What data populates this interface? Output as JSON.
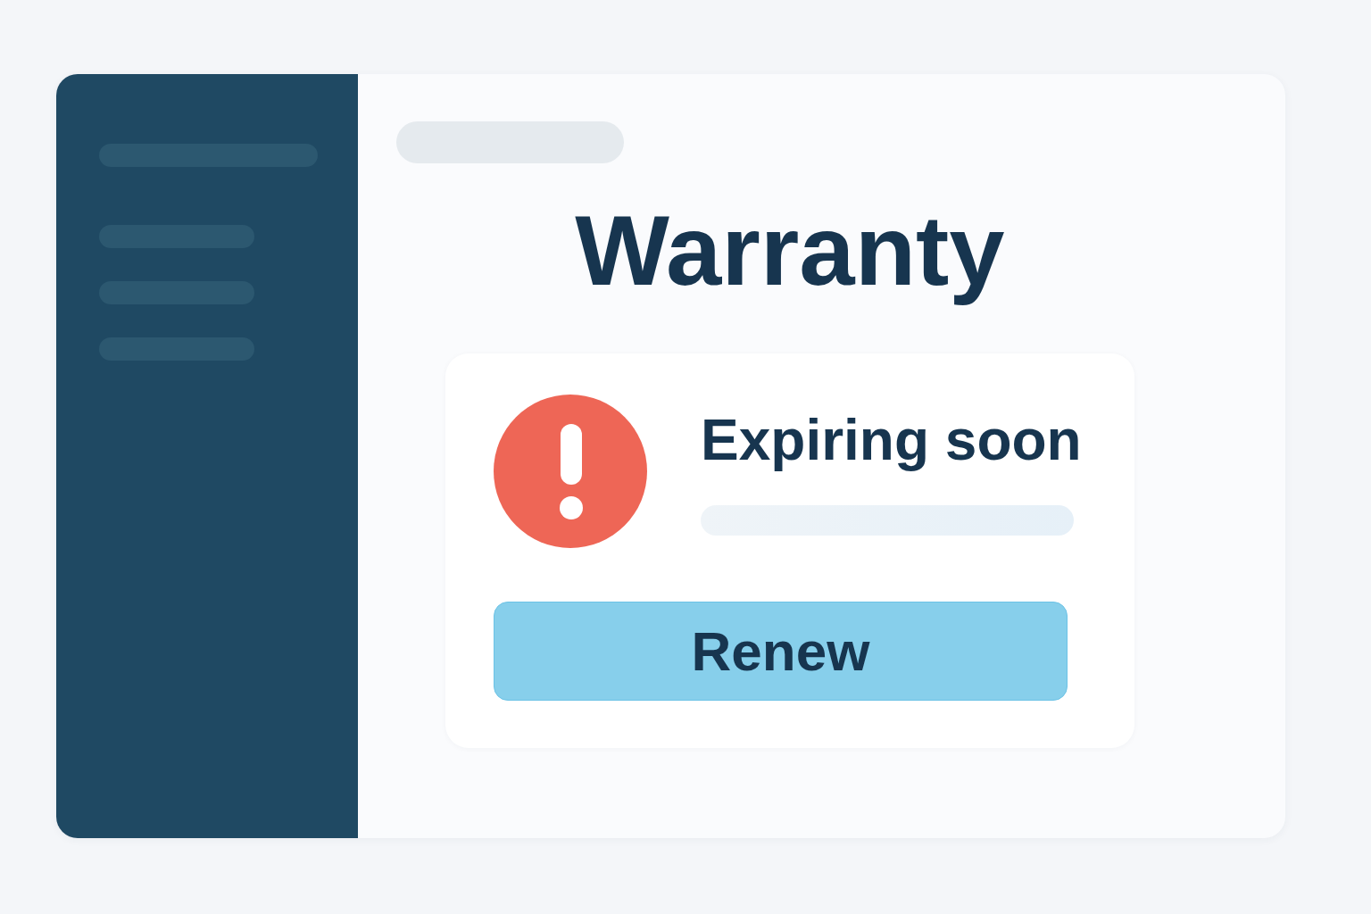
{
  "title": "Warranty",
  "status_card": {
    "status": "Expiring soon",
    "button": "Renew"
  }
}
